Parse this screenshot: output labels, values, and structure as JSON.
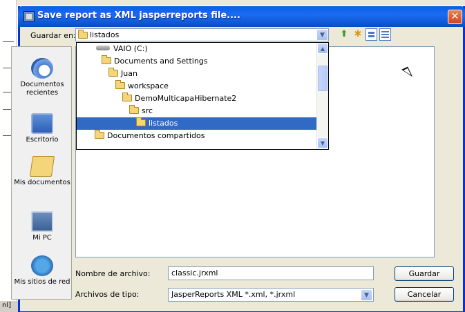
{
  "window": {
    "title": "Save report as XML jasperreports file...."
  },
  "lookin": {
    "label": "Guardar en:",
    "value": "listados"
  },
  "toolbar": {
    "up_icon": "up-folder-icon",
    "new_folder_icon": "new-folder-icon",
    "views_icon": "view-list-icon",
    "details_icon": "view-details-icon"
  },
  "places": [
    {
      "label": "Documentos recientes",
      "icon": "recent-documents-icon"
    },
    {
      "label": "Escritorio",
      "icon": "desktop-icon"
    },
    {
      "label": "Mis documentos",
      "icon": "my-documents-icon"
    },
    {
      "label": "Mi PC",
      "icon": "my-computer-icon"
    },
    {
      "label": "Mis sitios de red",
      "icon": "network-places-icon"
    }
  ],
  "dropdown": {
    "items": [
      {
        "label": "VAIO (C:)",
        "level": 1,
        "icon": "drive-icon"
      },
      {
        "label": "Documents and Settings",
        "level": 2,
        "icon": "folder-icon"
      },
      {
        "label": "Juan",
        "level": 3,
        "icon": "folder-icon"
      },
      {
        "label": "workspace",
        "level": 4,
        "icon": "folder-icon"
      },
      {
        "label": "DemoMulticapaHibernate2",
        "level": 5,
        "icon": "folder-icon"
      },
      {
        "label": "src",
        "level": 6,
        "icon": "folder-icon"
      },
      {
        "label": "listados",
        "level": 7,
        "icon": "folder-open-icon",
        "selected": true
      },
      {
        "label": "Documentos compartidos",
        "level": 2,
        "icon": "folder-icon"
      }
    ]
  },
  "filename": {
    "label": "Nombre de archivo:",
    "value": "classic.jrxml"
  },
  "filetype": {
    "label": "Archivos de tipo:",
    "value": "JasperReports XML *.xml, *.jrxml"
  },
  "buttons": {
    "save": "Guardar",
    "cancel": "Cancelar",
    "close": "✕"
  },
  "background": {
    "fragment": "nl]"
  },
  "colors": {
    "titlebar": "#0a5ee6",
    "selection": "#316ac5",
    "dialog_bg": "#ece9d8"
  }
}
